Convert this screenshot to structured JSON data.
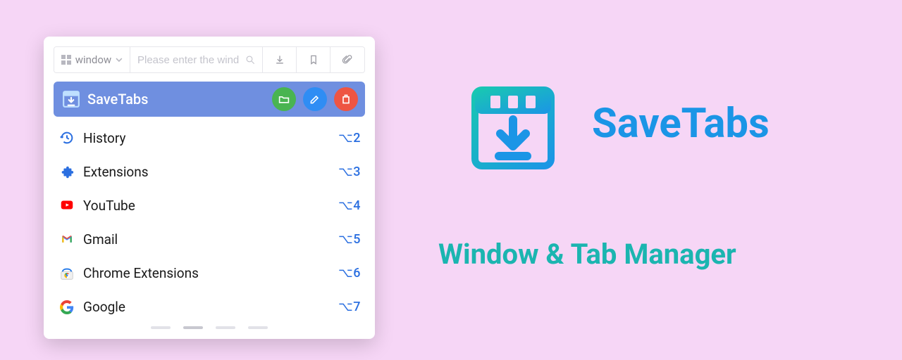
{
  "toolbar": {
    "window_selector_label": "window",
    "search_placeholder": "Please enter the wind"
  },
  "active": {
    "title": "SaveTabs"
  },
  "items": [
    {
      "label": "History",
      "shortcut": "⌥2"
    },
    {
      "label": "Extensions",
      "shortcut": "⌥3"
    },
    {
      "label": "YouTube",
      "shortcut": "⌥4"
    },
    {
      "label": "Gmail",
      "shortcut": "⌥5"
    },
    {
      "label": "Chrome Extensions",
      "shortcut": "⌥6"
    },
    {
      "label": "Google",
      "shortcut": "⌥7"
    }
  ],
  "hero": {
    "title": "SaveTabs",
    "subtitle": "Window & Tab Manager"
  }
}
